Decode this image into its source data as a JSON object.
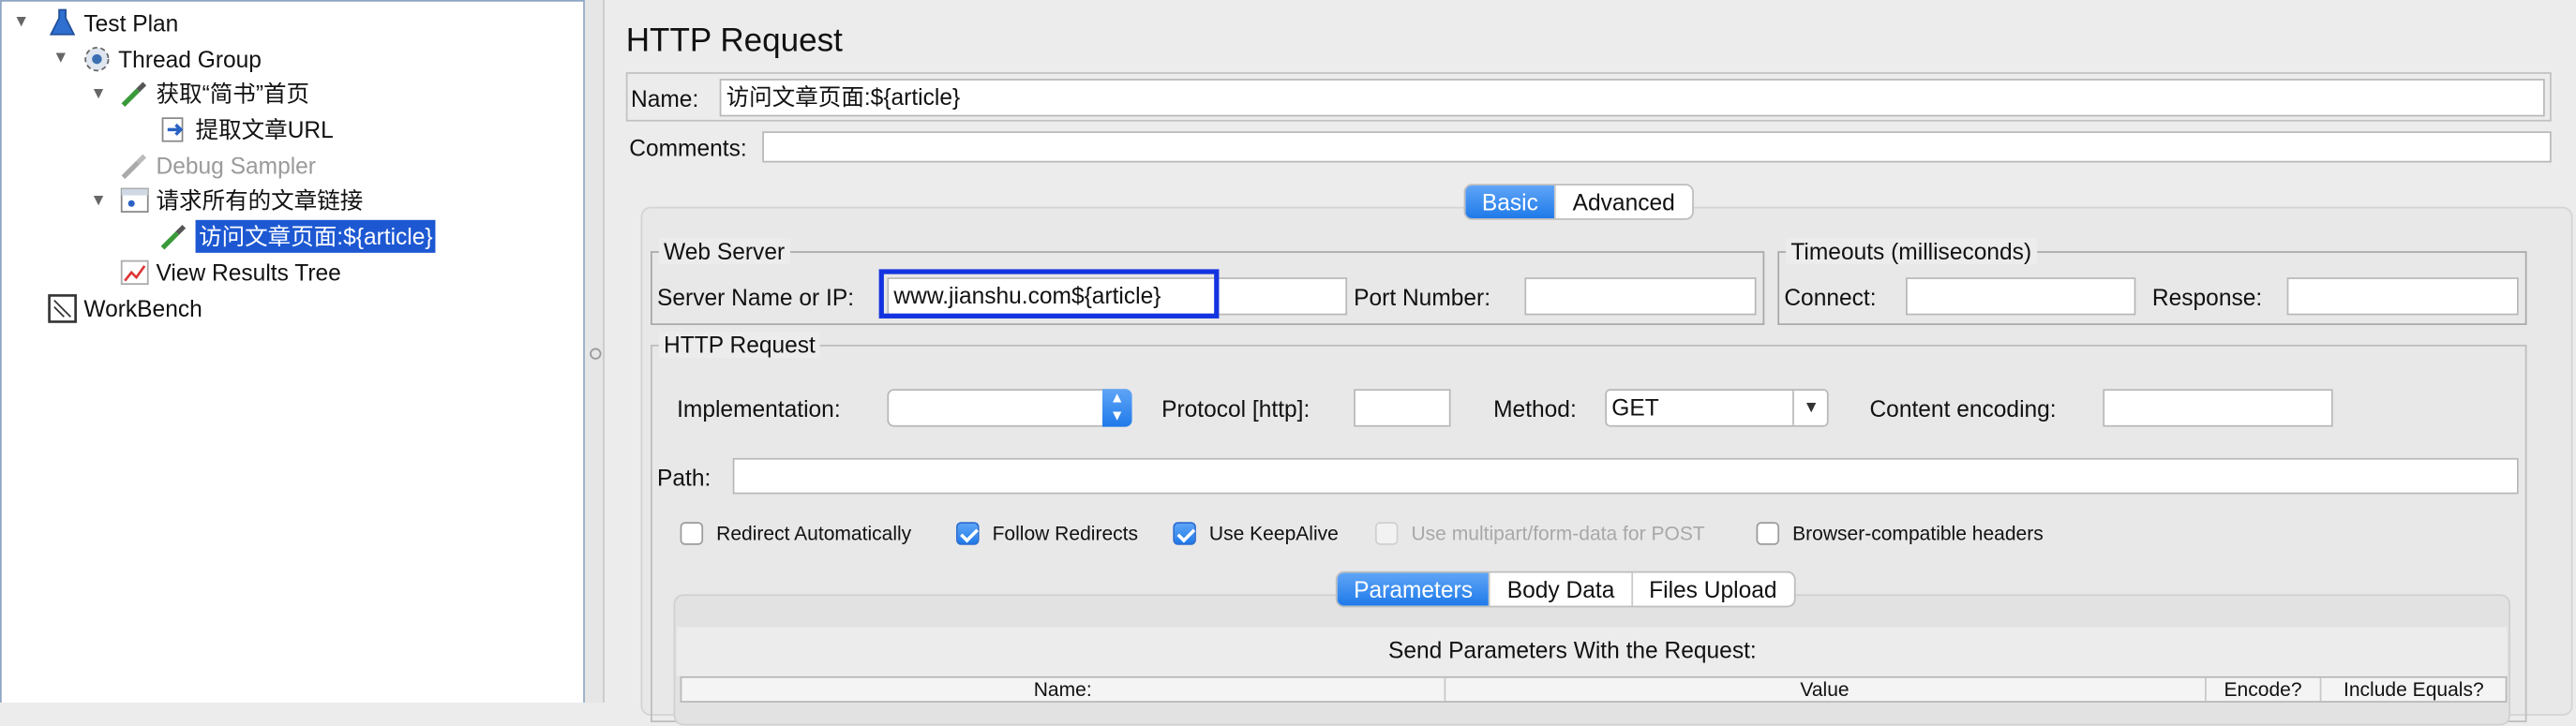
{
  "tree": {
    "items": [
      {
        "label": "Test Plan",
        "icon": "flask-icon"
      },
      {
        "label": "Thread Group",
        "icon": "gear-icon"
      },
      {
        "label": "获取“简书”首页",
        "icon": "pipette-icon"
      },
      {
        "label": "提取文章URL",
        "icon": "extractor-icon"
      },
      {
        "label": "Debug Sampler",
        "icon": "pipette-disabled-icon"
      },
      {
        "label": "请求所有的文章链接",
        "icon": "controller-icon"
      },
      {
        "label": "访问文章页面:${article}",
        "icon": "pipette-icon"
      },
      {
        "label": "View Results Tree",
        "icon": "chart-icon"
      },
      {
        "label": "WorkBench",
        "icon": "workbench-icon"
      }
    ]
  },
  "panel": {
    "title": "HTTP Request",
    "name_label": "Name:",
    "name_value": "访问文章页面:${article}",
    "comments_label": "Comments:",
    "comments_value": "",
    "tabs": [
      "Basic",
      "Advanced"
    ],
    "web_server": {
      "title": "Web Server",
      "server_label": "Server Name or IP:",
      "server_value": "www.jianshu.com${article}",
      "port_label": "Port Number:",
      "port_value": ""
    },
    "timeouts": {
      "title": "Timeouts (milliseconds)",
      "connect_label": "Connect:",
      "response_label": "Response:"
    },
    "http_request": {
      "title": "HTTP Request",
      "implementation_label": "Implementation:",
      "implementation_value": "",
      "protocol_label": "Protocol [http]:",
      "protocol_value": "",
      "method_label": "Method:",
      "method_value": "GET",
      "encoding_label": "Content encoding:",
      "encoding_value": "",
      "path_label": "Path:",
      "path_value": ""
    },
    "checkboxes": [
      {
        "label": "Redirect Automatically",
        "checked": false
      },
      {
        "label": "Follow Redirects",
        "checked": true
      },
      {
        "label": "Use KeepAlive",
        "checked": true
      },
      {
        "label": "Use multipart/form-data for POST",
        "checked": false,
        "disabled": true
      },
      {
        "label": "Browser-compatible headers",
        "checked": false
      }
    ],
    "param_tabs": [
      "Parameters",
      "Body Data",
      "Files Upload"
    ],
    "params_heading": "Send Parameters With the Request:",
    "columns": [
      "Name:",
      "Value",
      "Encode?",
      "Include Equals?"
    ],
    "highlight_color": "#1433e0",
    "selection_color": "#1d58d2"
  }
}
